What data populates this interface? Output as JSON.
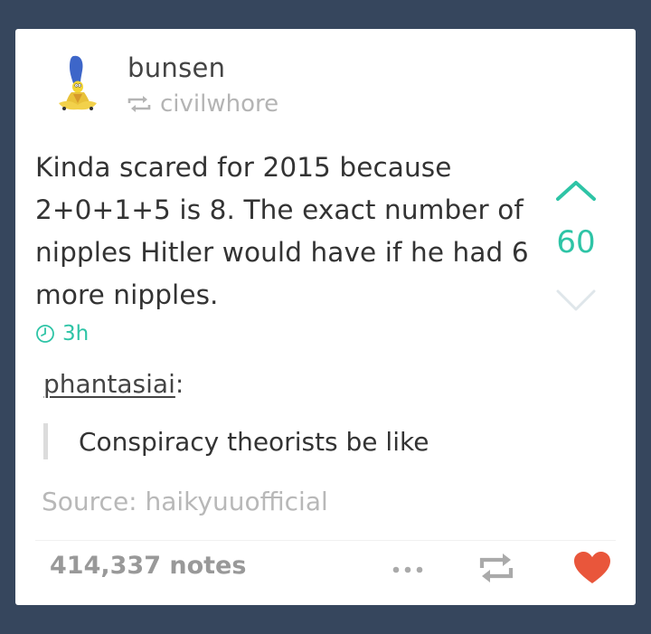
{
  "post": {
    "username": "bunsen",
    "reblogged_from": "civilwhore",
    "text": "Kinda scared for 2015 because 2+0+1+5 is 8. The exact number of nipples Hitler would have if he had 6 more nipples.",
    "time": "3h",
    "vote_count": "60",
    "reblogger_name": "phantasiai",
    "reblogger_colon": ":",
    "quote": "Conspiracy theorists be like",
    "source": "Source: haikyuuofficial",
    "notes": "414,337 notes"
  },
  "icons": {
    "avatar": "marge-simpson-avatar",
    "reblog_small": "reblog-icon",
    "upvote": "chevron-up-icon",
    "downvote": "chevron-down-icon",
    "clock": "clock-icon",
    "more": "more-dots-icon",
    "reblog": "reblog-icon",
    "like": "heart-icon"
  },
  "colors": {
    "background": "#36465d",
    "card": "#ffffff",
    "accent": "#2ec4a6",
    "like": "#e9563b",
    "muted": "#b4b4b4"
  }
}
